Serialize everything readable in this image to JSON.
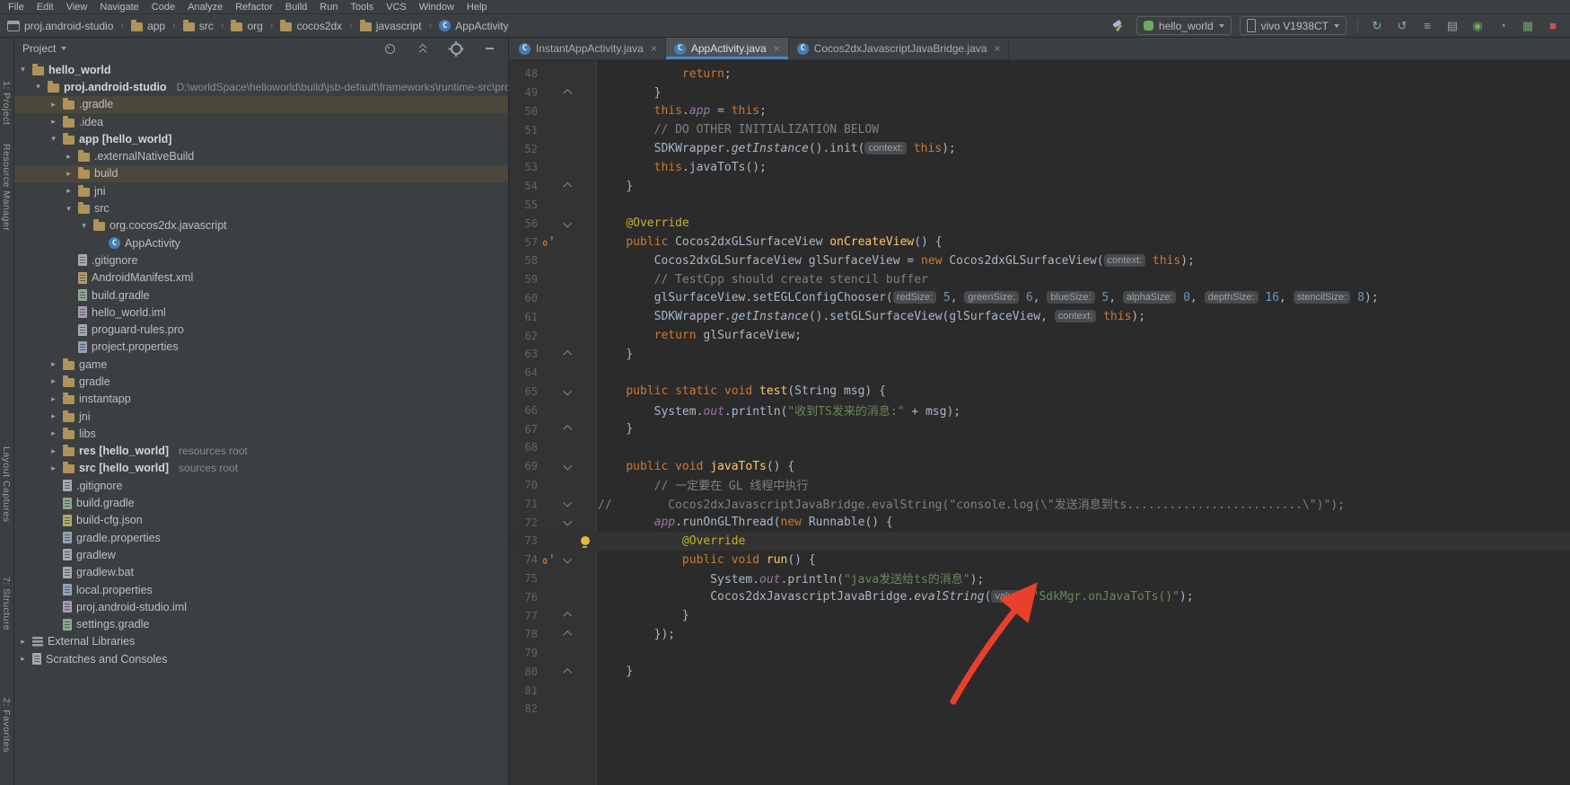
{
  "colors": {
    "panel_bg": "#3c3f41",
    "editor_bg": "#2b2b2b",
    "accent_blue": "#4a88c7",
    "selection_olive": "#4b483b",
    "annotation_red": "#e8402a"
  },
  "menubar": {
    "items": [
      "File",
      "Edit",
      "View",
      "Navigate",
      "Code",
      "Analyze",
      "Refactor",
      "Build",
      "Run",
      "Tools",
      "VCS",
      "Window",
      "Help"
    ]
  },
  "toolbar": {
    "breadcrumbs": [
      {
        "label": "proj.android-studio",
        "icon": "project-icon"
      },
      {
        "label": "app",
        "icon": "folder-icon"
      },
      {
        "label": "src",
        "icon": "folder-icon"
      },
      {
        "label": "org",
        "icon": "folder-icon"
      },
      {
        "label": "cocos2dx",
        "icon": "folder-icon"
      },
      {
        "label": "javascript",
        "icon": "folder-icon"
      },
      {
        "label": "AppActivity",
        "icon": "class-icon"
      }
    ],
    "run_config": {
      "icon": "module-icon",
      "label": "hello_world"
    },
    "device_selector": {
      "icon": "phone-icon",
      "label": "vivo V1938CT"
    },
    "right_icons": [
      {
        "name": "sync-project-icon",
        "glyph": "↻",
        "color": "#79b8ab"
      },
      {
        "name": "sync-gradle-icon",
        "glyph": "↺",
        "color": "#9da0a3"
      },
      {
        "name": "build-variants-icon",
        "glyph": "≡",
        "color": "#9da0a3"
      },
      {
        "name": "device-file-explorer-icon",
        "glyph": "▤",
        "color": "#9da0a3"
      },
      {
        "name": "attach-debugger-icon",
        "glyph": "◉",
        "color": "#68b05c"
      },
      {
        "name": "profiler-icon",
        "glyph": "◔",
        "color": "#5f9bd6"
      },
      {
        "name": "layout-inspector-icon",
        "glyph": "▦",
        "color": "#6aa857"
      },
      {
        "name": "stop-icon",
        "glyph": "■",
        "color": "#c75450"
      }
    ]
  },
  "tool_stripe": {
    "items": [
      "1: Project",
      "Resource Manager",
      "Layout Captures",
      "7: Structure",
      "2: Favorites"
    ]
  },
  "project_panel": {
    "title": "Project",
    "header_icons": [
      {
        "name": "locate-file-icon"
      },
      {
        "name": "collapse-all-icon"
      },
      {
        "name": "settings-gear-icon"
      },
      {
        "name": "hide-panel-icon"
      }
    ],
    "tree": [
      {
        "l": 0,
        "a": "e",
        "i": "folder-icon",
        "label": "hello_world",
        "b": 1
      },
      {
        "l": 1,
        "a": "e",
        "i": "folder-icon",
        "label": "proj.android-studio",
        "b": 1,
        "suffix": "D:\\worldSpace\\helloworld\\build\\jsb-default\\frameworks\\runtime-src\\proj.and..."
      },
      {
        "l": 2,
        "a": "c",
        "i": "folder-icon",
        "label": ".gradle",
        "sel": 1
      },
      {
        "l": 2,
        "a": "c",
        "i": "folder-icon",
        "label": ".idea"
      },
      {
        "l": 2,
        "a": "e",
        "i": "folder-icon",
        "label": "app [hello_world]",
        "b": 1
      },
      {
        "l": 3,
        "a": "c",
        "i": "folder-icon",
        "label": ".externalNativeBuild"
      },
      {
        "l": 3,
        "a": "c",
        "i": "folder-icon",
        "label": "build",
        "sel": 1
      },
      {
        "l": 3,
        "a": "c",
        "i": "folder-icon",
        "label": "jni"
      },
      {
        "l": 3,
        "a": "e",
        "i": "folder-icon",
        "label": "src"
      },
      {
        "l": 4,
        "a": "e",
        "i": "package-icon",
        "label": "org.cocos2dx.javascript"
      },
      {
        "l": 5,
        "a": "",
        "i": "class-icon",
        "label": "AppActivity"
      },
      {
        "l": 3,
        "a": "",
        "i": "file-icon",
        "label": ".gitignore"
      },
      {
        "l": 3,
        "a": "",
        "i": "xml-file-icon",
        "label": "AndroidManifest.xml"
      },
      {
        "l": 3,
        "a": "",
        "i": "gradle-file-icon",
        "label": "build.gradle"
      },
      {
        "l": 3,
        "a": "",
        "i": "iml-file-icon",
        "label": "hello_world.iml"
      },
      {
        "l": 3,
        "a": "",
        "i": "file-icon",
        "label": "proguard-rules.pro"
      },
      {
        "l": 3,
        "a": "",
        "i": "properties-file-icon",
        "label": "project.properties"
      },
      {
        "l": 2,
        "a": "c",
        "i": "folder-icon",
        "label": "game"
      },
      {
        "l": 2,
        "a": "c",
        "i": "folder-icon",
        "label": "gradle"
      },
      {
        "l": 2,
        "a": "c",
        "i": "folder-icon",
        "label": "instantapp"
      },
      {
        "l": 2,
        "a": "c",
        "i": "folder-icon",
        "label": "jni"
      },
      {
        "l": 2,
        "a": "c",
        "i": "folder-icon",
        "label": "libs"
      },
      {
        "l": 2,
        "a": "c",
        "i": "folder-icon",
        "label": "res [hello_world]",
        "b": 1,
        "suffix": "resources root"
      },
      {
        "l": 2,
        "a": "c",
        "i": "folder-icon",
        "label": "src [hello_world]",
        "b": 1,
        "suffix": "sources root"
      },
      {
        "l": 2,
        "a": "",
        "i": "file-icon",
        "label": ".gitignore"
      },
      {
        "l": 2,
        "a": "",
        "i": "gradle-file-icon",
        "label": "build.gradle"
      },
      {
        "l": 2,
        "a": "",
        "i": "json-file-icon",
        "label": "build-cfg.json"
      },
      {
        "l": 2,
        "a": "",
        "i": "properties-file-icon",
        "label": "gradle.properties"
      },
      {
        "l": 2,
        "a": "",
        "i": "file-icon",
        "label": "gradlew"
      },
      {
        "l": 2,
        "a": "",
        "i": "file-icon",
        "label": "gradlew.bat"
      },
      {
        "l": 2,
        "a": "",
        "i": "properties-file-icon",
        "label": "local.properties"
      },
      {
        "l": 2,
        "a": "",
        "i": "iml-file-icon",
        "label": "proj.android-studio.iml"
      },
      {
        "l": 2,
        "a": "",
        "i": "gradle-file-icon",
        "label": "settings.gradle"
      },
      {
        "l": 0,
        "a": "c",
        "i": "libraries-icon",
        "label": "External Libraries"
      },
      {
        "l": 0,
        "a": "c",
        "i": "scratches-icon",
        "label": "Scratches and Consoles"
      }
    ]
  },
  "editor": {
    "tabs": [
      {
        "label": "InstantAppActivity.java",
        "icon": "class-icon",
        "close": "×",
        "active": false
      },
      {
        "label": "AppActivity.java",
        "icon": "class-icon",
        "close": "×",
        "active": true
      },
      {
        "label": "Cocos2dxJavascriptJavaBridge.java",
        "icon": "class-icon",
        "close": "×",
        "active": false
      }
    ],
    "lines": [
      {
        "n": 48,
        "ind": 12,
        "seg": [
          [
            "return",
            "kw"
          ],
          [
            ";",
            "pl"
          ]
        ]
      },
      {
        "n": 49,
        "ind": 8,
        "f": "u",
        "seg": [
          [
            "}",
            "pl"
          ]
        ]
      },
      {
        "n": 50,
        "ind": 8,
        "seg": [
          [
            "this",
            "kw"
          ],
          [
            ".",
            "pl"
          ],
          [
            "app",
            "fld"
          ],
          [
            " = ",
            "pl"
          ],
          [
            "this",
            "kw"
          ],
          [
            ";",
            "pl"
          ]
        ]
      },
      {
        "n": 51,
        "ind": 8,
        "seg": [
          [
            "// DO OTHER INITIALIZATION BELOW",
            "cmt"
          ]
        ]
      },
      {
        "n": 52,
        "ind": 8,
        "seg": [
          [
            "SDKWrapper.",
            "pl"
          ],
          [
            "getInstance",
            "stm"
          ],
          [
            "().init(",
            "pl"
          ],
          [
            "context:",
            "inl"
          ],
          [
            " ",
            "pl"
          ],
          [
            "this",
            "kw"
          ],
          [
            ");",
            "pl"
          ]
        ]
      },
      {
        "n": 53,
        "ind": 8,
        "seg": [
          [
            "this",
            "kw"
          ],
          [
            ".javaToTs();",
            "pl"
          ]
        ]
      },
      {
        "n": 54,
        "ind": 4,
        "f": "u",
        "seg": [
          [
            "}",
            "pl"
          ]
        ]
      },
      {
        "n": 55,
        "ind": 0,
        "seg": []
      },
      {
        "n": 56,
        "ind": 4,
        "f": "d",
        "seg": [
          [
            "@Override",
            "ann"
          ]
        ]
      },
      {
        "n": 57,
        "ind": 4,
        "ic": "override",
        "seg": [
          [
            "public ",
            "kw"
          ],
          [
            "Cocos2dxGLSurfaceView ",
            "pl"
          ],
          [
            "onCreateView",
            "decl"
          ],
          [
            "() {",
            "pl"
          ]
        ]
      },
      {
        "n": 58,
        "ind": 8,
        "seg": [
          [
            "Cocos2dxGLSurfaceView glSurfaceView = ",
            "pl"
          ],
          [
            "new ",
            "kw"
          ],
          [
            "Cocos2dxGLSurfaceView(",
            "pl"
          ],
          [
            "context:",
            "inl"
          ],
          [
            " ",
            "pl"
          ],
          [
            "this",
            "kw"
          ],
          [
            ");",
            "pl"
          ]
        ]
      },
      {
        "n": 59,
        "ind": 8,
        "seg": [
          [
            "// TestCpp should create stencil buffer",
            "cmt"
          ]
        ]
      },
      {
        "n": 60,
        "ind": 8,
        "seg": [
          [
            "glSurfaceView.setEGLConfigChooser(",
            "pl"
          ],
          [
            "redSize:",
            "inl"
          ],
          [
            " ",
            "pl"
          ],
          [
            "5",
            "num"
          ],
          [
            ", ",
            "pl"
          ],
          [
            "greenSize:",
            "inl"
          ],
          [
            " ",
            "pl"
          ],
          [
            "6",
            "num"
          ],
          [
            ", ",
            "pl"
          ],
          [
            "blueSize:",
            "inl"
          ],
          [
            " ",
            "pl"
          ],
          [
            "5",
            "num"
          ],
          [
            ", ",
            "pl"
          ],
          [
            "alphaSize:",
            "inl"
          ],
          [
            " ",
            "pl"
          ],
          [
            "0",
            "num"
          ],
          [
            ", ",
            "pl"
          ],
          [
            "depthSize:",
            "inl"
          ],
          [
            " ",
            "pl"
          ],
          [
            "16",
            "num"
          ],
          [
            ", ",
            "pl"
          ],
          [
            "stencilSize:",
            "inl"
          ],
          [
            " ",
            "pl"
          ],
          [
            "8",
            "num"
          ],
          [
            ");",
            "pl"
          ]
        ]
      },
      {
        "n": 61,
        "ind": 8,
        "seg": [
          [
            "SDKWrapper.",
            "pl"
          ],
          [
            "getInstance",
            "stm"
          ],
          [
            "().setGLSurfaceView(glSurfaceView, ",
            "pl"
          ],
          [
            "context:",
            "inl"
          ],
          [
            " ",
            "pl"
          ],
          [
            "this",
            "kw"
          ],
          [
            ");",
            "pl"
          ]
        ]
      },
      {
        "n": 62,
        "ind": 8,
        "seg": [
          [
            "return ",
            "kw"
          ],
          [
            "glSurfaceView;",
            "pl"
          ]
        ]
      },
      {
        "n": 63,
        "ind": 4,
        "f": "u",
        "seg": [
          [
            "}",
            "pl"
          ]
        ]
      },
      {
        "n": 64,
        "ind": 0,
        "seg": []
      },
      {
        "n": 65,
        "ind": 4,
        "f": "d",
        "seg": [
          [
            "public static void ",
            "kw"
          ],
          [
            "test",
            "decl"
          ],
          [
            "(String msg) {",
            "pl"
          ]
        ]
      },
      {
        "n": 66,
        "ind": 8,
        "seg": [
          [
            "System.",
            "pl"
          ],
          [
            "out",
            "fld"
          ],
          [
            ".println(",
            "pl"
          ],
          [
            "\"收到TS发来的消息:\"",
            "str"
          ],
          [
            " + msg);",
            "pl"
          ]
        ]
      },
      {
        "n": 67,
        "ind": 4,
        "f": "u",
        "seg": [
          [
            "}",
            "pl"
          ]
        ]
      },
      {
        "n": 68,
        "ind": 0,
        "seg": []
      },
      {
        "n": 69,
        "ind": 4,
        "f": "d",
        "seg": [
          [
            "public void ",
            "kw"
          ],
          [
            "javaToTs",
            "decl"
          ],
          [
            "() {",
            "pl"
          ]
        ]
      },
      {
        "n": 70,
        "ind": 8,
        "seg": [
          [
            "// 一定要在 GL 线程中执行",
            "cmt"
          ]
        ]
      },
      {
        "n": 71,
        "ind": 0,
        "f": "d",
        "seg": [
          [
            "//        Cocos2dxJavascriptJavaBridge.evalString(\"console.log(\\\"发送消息到ts.........................\\\")\");",
            "cmt"
          ]
        ]
      },
      {
        "n": 72,
        "ind": 8,
        "f": "d",
        "seg": [
          [
            "app",
            "fld"
          ],
          [
            ".runOnGLThread(",
            "pl"
          ],
          [
            "new ",
            "kw"
          ],
          [
            "Runnable",
            "pl"
          ],
          [
            "() {",
            "pl"
          ]
        ]
      },
      {
        "n": 73,
        "ind": 12,
        "ic": "bulb",
        "cur": 1,
        "seg": [
          [
            "@Override",
            "ann"
          ]
        ]
      },
      {
        "n": 74,
        "ind": 12,
        "ic": "override",
        "f": "d",
        "seg": [
          [
            "public void ",
            "kw"
          ],
          [
            "run",
            "decl"
          ],
          [
            "() {",
            "pl"
          ]
        ]
      },
      {
        "n": 75,
        "ind": 16,
        "seg": [
          [
            "System.",
            "pl"
          ],
          [
            "out",
            "fld"
          ],
          [
            ".println(",
            "pl"
          ],
          [
            "\"java发送给ts的消息\"",
            "str"
          ],
          [
            ");",
            "pl"
          ]
        ]
      },
      {
        "n": 76,
        "ind": 16,
        "seg": [
          [
            "Cocos2dxJavascriptJavaBridge.",
            "pl"
          ],
          [
            "evalString",
            "stm"
          ],
          [
            "(",
            "pl"
          ],
          [
            "value:",
            "inl"
          ],
          [
            " ",
            "pl"
          ],
          [
            "\"SdkMgr.onJavaToTs()\"",
            "str"
          ],
          [
            ");",
            "pl"
          ]
        ]
      },
      {
        "n": 77,
        "ind": 12,
        "f": "u",
        "seg": [
          [
            "}",
            "pl"
          ]
        ]
      },
      {
        "n": 78,
        "ind": 8,
        "f": "u",
        "seg": [
          [
            "});",
            "pl"
          ]
        ]
      },
      {
        "n": 79,
        "ind": 0,
        "seg": []
      },
      {
        "n": 80,
        "ind": 4,
        "f": "u",
        "seg": [
          [
            "}",
            "pl"
          ]
        ]
      },
      {
        "n": 81,
        "ind": 0,
        "seg": []
      },
      {
        "n": 82,
        "ind": 0,
        "seg": []
      }
    ]
  },
  "annotation": {
    "type": "arrow",
    "color": "#e8402a"
  }
}
